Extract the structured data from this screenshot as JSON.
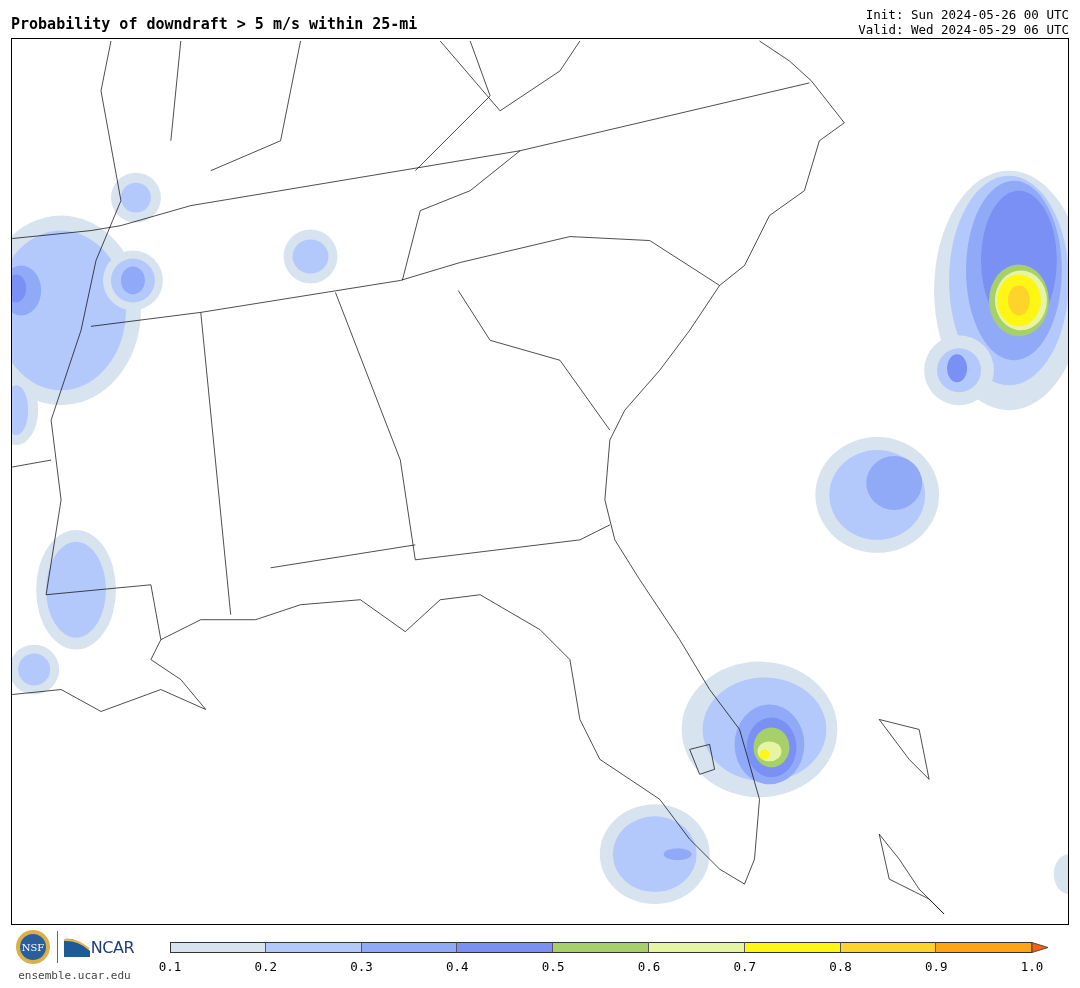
{
  "header": {
    "title": "Probability of downdraft > 5 m/s within 25-mi",
    "init": "Init: Sun 2024-05-26 00 UTC",
    "valid": "Valid: Wed 2024-05-29 06 UTC"
  },
  "footer": {
    "nsf_logo_text": "NSF",
    "ncar_logo_text": "NCAR",
    "website": "ensemble.ucar.edu"
  },
  "colorbar": {
    "bins": [
      {
        "color": "#d7e3ef"
      },
      {
        "color": "#b3c8fb"
      },
      {
        "color": "#91aaf8"
      },
      {
        "color": "#7b90f5"
      },
      {
        "color": "#a8d06a"
      },
      {
        "color": "#e6f5a3"
      },
      {
        "color": "#fff614"
      },
      {
        "color": "#ffd42a"
      },
      {
        "color": "#ffa514"
      }
    ],
    "extend": {
      "color": "#f06016"
    },
    "ticks": [
      "0.1",
      "0.2",
      "0.3",
      "0.4",
      "0.5",
      "0.6",
      "0.7",
      "0.8",
      "0.9",
      "1.0"
    ]
  }
}
